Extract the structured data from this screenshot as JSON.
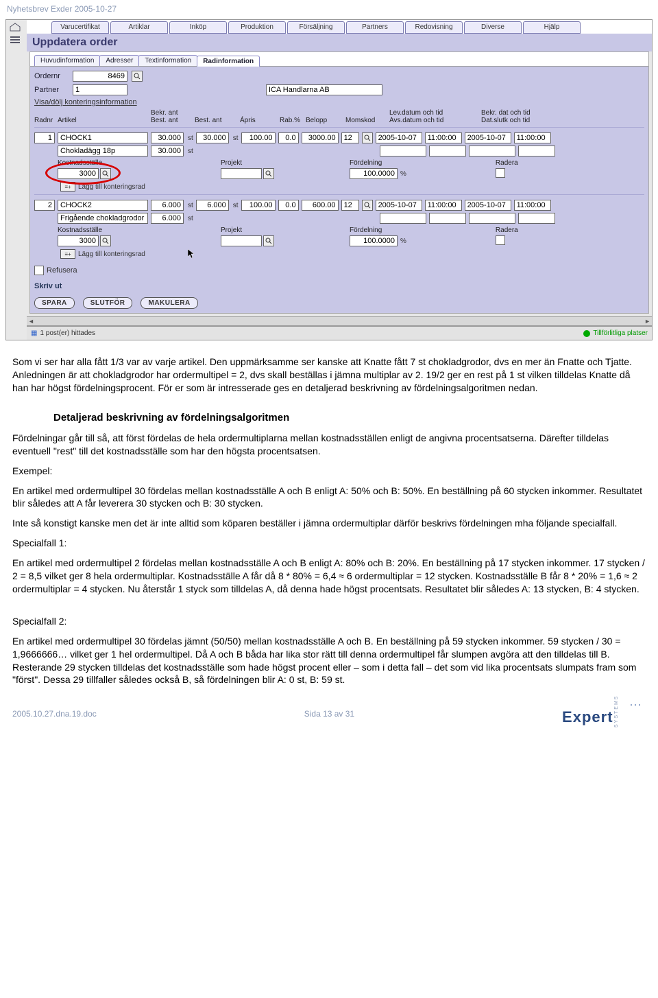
{
  "page_header": "Nyhetsbrev Exder 2005-10-27",
  "menu": [
    "Varucertifikat",
    "Artiklar",
    "Inköp",
    "Produktion",
    "Försäljning",
    "Partners",
    "Redovisning",
    "Diverse",
    "Hjälp"
  ],
  "title": "Uppdatera order",
  "subtabs": [
    "Huvudinformation",
    "Adresser",
    "Textinformation",
    "Radinformation"
  ],
  "active_subtab": 3,
  "header_form": {
    "order_lbl": "Ordernr",
    "order_val": "8469",
    "partner_lbl": "Partner",
    "partner_val": "1",
    "partner_name": "ICA Handlarna AB"
  },
  "section_link": "Visa/dölj konteringsinformation",
  "grid_headers": {
    "radnr": "Radnr",
    "artikel": "Artikel",
    "bekr_ant": "Bekr. ant",
    "best_ant_stub": "Best. ant",
    "best_ant": "Best. ant",
    "apris": "Ápris",
    "rab": "Rab.%",
    "belopp": "Belopp",
    "momskod": "Momskod",
    "lev": "Lev.datum och tid",
    "avs": "Avs.datum och tid",
    "bekr": "Bekr. dat och tid",
    "slutk": "Dat.slutk och tid"
  },
  "st": "st",
  "pct": "%",
  "rows": [
    {
      "n": "1",
      "art": "CHOCK1",
      "desc": "Chokladägg 18p",
      "bekr": "30.000",
      "best": "30.000",
      "best2": "30.000",
      "apris": "100.00",
      "rab": "0.0",
      "belopp": "3000.00",
      "moms": "12",
      "d1": "2005-10-07",
      "t1": "11:00:00",
      "d2": "2005-10-07",
      "t2": "11:00:00",
      "ks_lbl": "Kostnadsställe",
      "proj_lbl": "Projekt",
      "ford_lbl": "Fördelning",
      "radera_lbl": "Radera",
      "ks_val": "3000",
      "ford_val": "100.0000",
      "add_lbl": "Lägg till konteringsrad"
    },
    {
      "n": "2",
      "art": "CHOCK2",
      "desc": "Frigående chokladgrodor",
      "bekr": "6.000",
      "best": "6.000",
      "best2": "6.000",
      "apris": "100.00",
      "rab": "0.0",
      "belopp": "600.00",
      "moms": "12",
      "d1": "2005-10-07",
      "t1": "11:00:00",
      "d2": "2005-10-07",
      "t2": "11:00:00",
      "ks_lbl": "Kostnadsställe",
      "proj_lbl": "Projekt",
      "ford_lbl": "Fördelning",
      "radera_lbl": "Radera",
      "ks_val": "3000",
      "ford_val": "100.0000",
      "add_lbl": "Lägg till konteringsrad"
    }
  ],
  "refusera": "Refusera",
  "skriv_ut": "Skriv ut",
  "buttons": [
    "SPARA",
    "SLUTFÖR",
    "MAKULERA"
  ],
  "status_left": "1 post(er) hittades",
  "status_right": "Tillförlitliga platser",
  "doc": {
    "p1": "Som vi ser har alla fått 1/3 var av varje artikel. Den uppmärksamme ser kanske att Knatte fått 7 st chokladgrodor, dvs en mer än Fnatte och Tjatte. Anledningen är att chokladgrodor har ordermultipel = 2, dvs skall beställas i jämna multiplar av 2. 19/2 ger en rest på 1 st vilken tilldelas Knatte då han har högst fördelningsprocent. För er som är intresserade ges en detaljerad beskrivning av fördelningsalgoritmen nedan.",
    "h3": "Detaljerad beskrivning av fördelningsalgoritmen",
    "p2": "Fördelningar går till så, att först fördelas de hela ordermultiplarna mellan kostnadsställen enligt de angivna procentsatserna. Därefter tilldelas eventuell \"rest\" till det kostnadsställe som har den högsta procentsatsen.",
    "p3": "Exempel:",
    "p4": "En artikel med ordermultipel 30 fördelas mellan kostnadsställe A och B enligt A: 50% och B: 50%. En beställning på 60 stycken inkommer. Resultatet blir således att A får leverera 30 stycken och B: 30 stycken.",
    "p5": "Inte så konstigt kanske men det är inte alltid som köparen beställer i jämna ordermultiplar därför beskrivs fördelningen mha följande specialfall.",
    "p6": "Specialfall 1:",
    "p7": "En artikel med ordermultipel 2 fördelas mellan kostnadsställe A och B enligt A: 80% och B: 20%. En beställning på 17 stycken inkommer. 17 stycken / 2 = 8,5 vilket ger 8 hela ordermultiplar. Kostnadsställe A får då 8 * 80% = 6,4 ≈ 6 ordermultiplar = 12 stycken. Kostnadsställe B får 8 * 20% = 1,6 ≈ 2 ordermultiplar = 4 stycken. Nu återstår 1 styck som tilldelas A, då denna hade högst procentsats. Resultatet blir således A: 13 stycken, B: 4 stycken.",
    "p8": "Specialfall 2:",
    "p9": "En artikel med ordermultipel 30 fördelas jämnt (50/50) mellan kostnadsställe A och B. En beställning på 59 stycken inkommer. 59 stycken / 30 = 1,9666666… vilket ger 1 hel ordermultipel. Då A och B båda har lika stor rätt till denna ordermultipel får slumpen avgöra att den tilldelas till B. Resterande 29 stycken tilldelas det kostnadsställe som hade högst procent eller – som i detta fall – det som vid lika procentsats slumpats fram som \"först\". Dessa 29 tillfaller således också B, så fördelningen blir A: 0 st, B: 59 st."
  },
  "footer": {
    "left": "2005.10.27.dna.19.doc",
    "center": "Sida 13 av 31",
    "brand": "Expert",
    "brand_sub": "SYSTEMS"
  }
}
